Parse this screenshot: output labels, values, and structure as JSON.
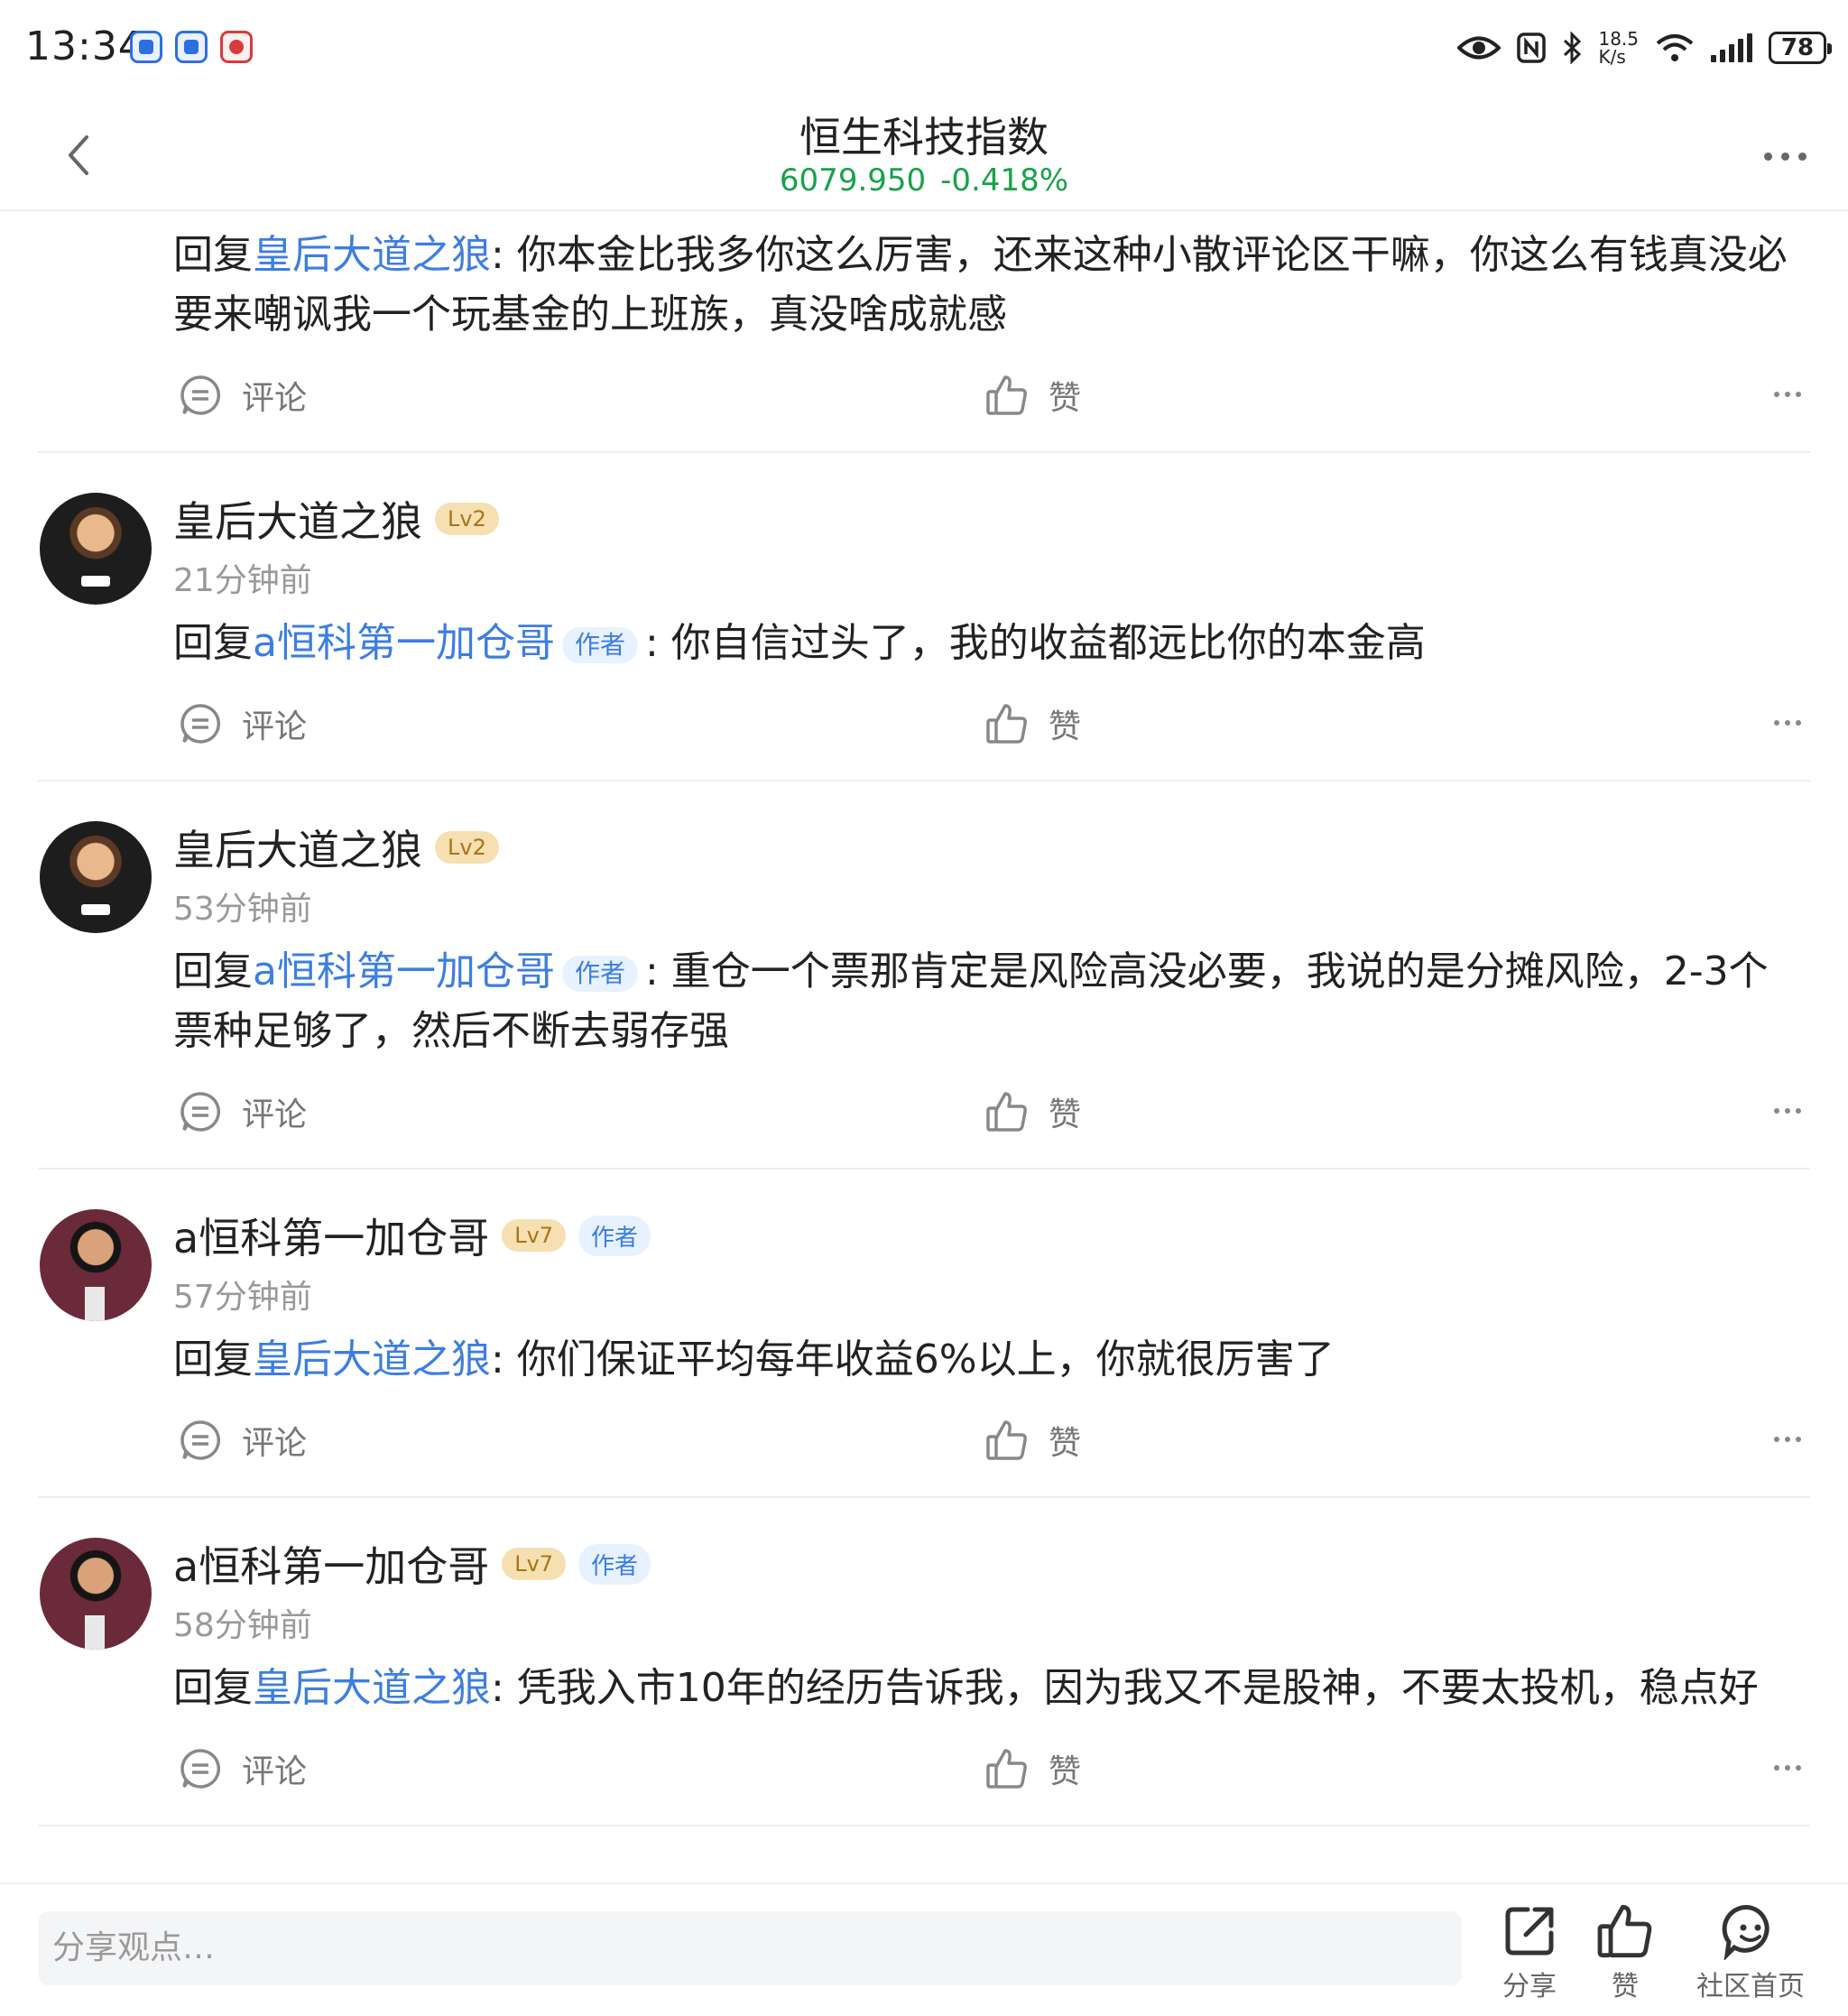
{
  "status_bar": {
    "time": "13:34",
    "net_speed_value": "18.5",
    "net_speed_unit": "K/s",
    "battery": "78",
    "icons": [
      "app-icon-1",
      "app-icon-2",
      "app-icon-3",
      "eye-icon",
      "nfc-icon",
      "bluetooth-icon",
      "wifi-icon",
      "signal-icon",
      "battery-icon"
    ]
  },
  "header": {
    "title": "恒生科技指数",
    "price": "6079.950",
    "change": "-0.418%",
    "price_color": "#19a24a"
  },
  "comments": [
    {
      "user": "",
      "level": "",
      "time": "",
      "reply_prefix": "回复",
      "reply_to": "皇后大道之狼",
      "text": ": 你本金比我多你这么厉害，还来这种小散评论区干嘛，你这么有钱真没必要来嘲讽我一个玩基金的上班族，真没啥成就感",
      "comment_label": "评论",
      "like_label": "赞"
    },
    {
      "user": "皇后大道之狼",
      "level": "Lv2",
      "time": "21分钟前",
      "reply_prefix": "回复",
      "reply_to": "a恒科第一加仓哥",
      "reply_to_badge": "作者",
      "text": ": 你自信过头了，我的收益都远比你的本金高",
      "comment_label": "评论",
      "like_label": "赞"
    },
    {
      "user": "皇后大道之狼",
      "level": "Lv2",
      "time": "53分钟前",
      "reply_prefix": "回复",
      "reply_to": "a恒科第一加仓哥",
      "reply_to_badge": "作者",
      "text": ": 重仓一个票那肯定是风险高没必要，我说的是分摊风险，2-3个票种足够了，然后不断去弱存强",
      "comment_label": "评论",
      "like_label": "赞"
    },
    {
      "user": "a恒科第一加仓哥",
      "level": "Lv7",
      "author_badge": "作者",
      "time": "57分钟前",
      "reply_prefix": "回复",
      "reply_to": "皇后大道之狼",
      "text": ": 你们保证平均每年收益6%以上，你就很厉害了",
      "comment_label": "评论",
      "like_label": "赞"
    },
    {
      "user": "a恒科第一加仓哥",
      "level": "Lv7",
      "author_badge": "作者",
      "time": "58分钟前",
      "reply_prefix": "回复",
      "reply_to": "皇后大道之狼",
      "text": ": 凭我入市10年的经历告诉我，因为我又不是股神，不要太投机，稳点好",
      "comment_label": "评论",
      "like_label": "赞"
    }
  ],
  "bottom_bar": {
    "input_placeholder": "分享观点…",
    "share_label": "分享",
    "like_label": "赞",
    "home_label": "社区首页"
  },
  "colors": {
    "link": "#3d7ee0",
    "badge_level_bg": "#f6dfb1",
    "badge_author_bg": "#e8f1fe"
  }
}
